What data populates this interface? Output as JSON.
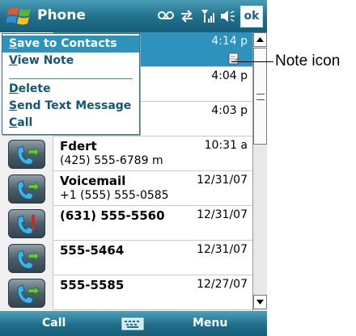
{
  "titlebar": {
    "title": "Phone",
    "ok_label": "ok",
    "status_icons": [
      "voicemail-icon",
      "connectivity-icon",
      "signal-icon",
      "volume-icon"
    ]
  },
  "menu": {
    "items": [
      {
        "label": "Save to Contacts",
        "accel": "S",
        "rest": "ave to Contacts",
        "highlighted": true
      },
      {
        "label": "View Note",
        "accel": "V",
        "rest": "iew Note",
        "highlighted": false
      },
      {
        "label": "Delete",
        "accel": "D",
        "rest": "elete",
        "highlighted": false
      },
      {
        "label": "Send Text Message",
        "accel": "S",
        "rest": "end Text Message",
        "highlighted": false
      },
      {
        "label": "Call",
        "accel": "C",
        "rest": "all",
        "highlighted": false
      }
    ]
  },
  "calls": [
    {
      "name": "",
      "number": "",
      "time": "4:14 p",
      "selected": true,
      "has_note": true,
      "icon": "outgoing-call-icon"
    },
    {
      "name": "",
      "number": "",
      "time": "4:04 p",
      "selected": false,
      "has_note": false,
      "icon": "outgoing-call-icon"
    },
    {
      "name": "",
      "number": "",
      "time": "4:03 p",
      "selected": false,
      "has_note": false,
      "icon": "outgoing-call-icon"
    },
    {
      "name": "Fdert",
      "number": "(425) 555-6789 m",
      "time": "10:31 a",
      "selected": false,
      "has_note": false,
      "icon": "outgoing-call-icon"
    },
    {
      "name": "Voicemail",
      "number": "+1 (555) 555-0585",
      "time": "12/31/07",
      "selected": false,
      "has_note": false,
      "icon": "outgoing-call-icon"
    },
    {
      "name": "(631) 555-5560",
      "number": "",
      "time": "12/31/07",
      "selected": false,
      "has_note": false,
      "icon": "missed-call-icon"
    },
    {
      "name": "555-5464",
      "number": "",
      "time": "12/31/07",
      "selected": false,
      "has_note": false,
      "icon": "outgoing-call-icon"
    },
    {
      "name": "555-5585",
      "number": "",
      "time": "12/27/07",
      "selected": false,
      "has_note": false,
      "icon": "outgoing-call-icon"
    }
  ],
  "bottombar": {
    "left_label": "Call",
    "right_label": "Menu",
    "center_icon": "keyboard-icon"
  },
  "callout": {
    "label": "Note icon"
  },
  "colors": {
    "bar": "#1f6f8c",
    "selection": "#2d93bc"
  }
}
